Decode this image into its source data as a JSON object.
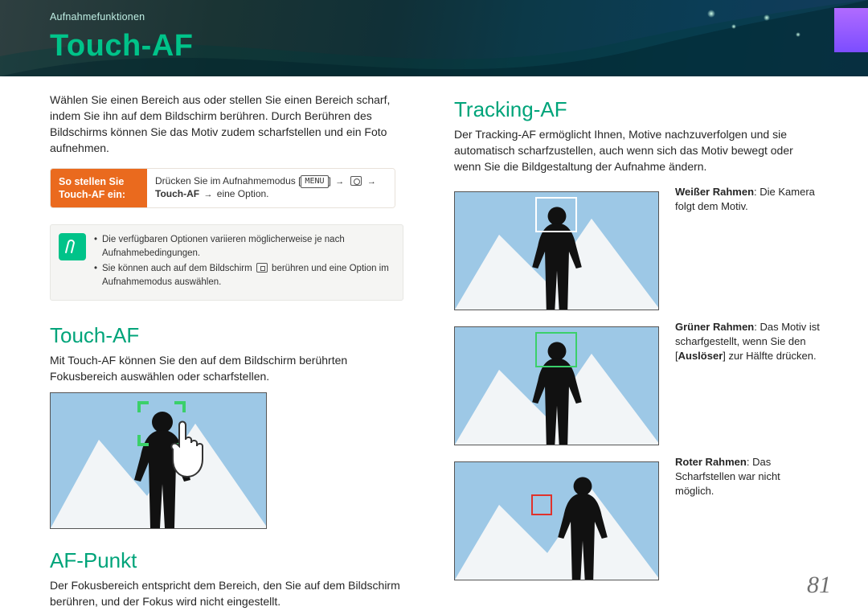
{
  "header": {
    "breadcrumb": "Aufnahmefunktionen",
    "title": "Touch-AF"
  },
  "left": {
    "intro": "Wählen Sie einen Bereich aus oder stellen Sie einen Bereich scharf, indem Sie ihn auf dem Bildschirm berühren. Durch Berühren des Bildschirms können Sie das Motiv zudem scharfstellen und ein Foto aufnehmen.",
    "instruct": {
      "label": "So stellen Sie Touch-AF ein:",
      "body_prefix": "Drücken Sie im Aufnahmemodus [",
      "body_menu": "MENU",
      "body_mid": "] ",
      "body_suffix": " eine Option.",
      "opt_strong": "Touch-AF"
    },
    "note": {
      "item1": "Die verfügbaren Optionen variieren möglicherweise je nach Aufnahmebedingungen.",
      "item2_a": "Sie können auch auf dem Bildschirm ",
      "item2_b": " berühren und eine Option im Aufnahmemodus auswählen."
    },
    "touch": {
      "heading": "Touch-AF",
      "body": "Mit Touch-AF können Sie den auf dem Bildschirm berührten Fokusbereich auswählen oder scharfstellen."
    },
    "afpunkt": {
      "heading": "AF-Punkt",
      "body": "Der Fokusbereich entspricht dem Bereich, den Sie auf dem Bildschirm berühren, und der Fokus wird nicht eingestellt."
    }
  },
  "right": {
    "heading": "Tracking-AF",
    "intro": "Der Tracking-AF ermöglicht Ihnen, Motive nachzuverfolgen und sie automatisch scharfzustellen, auch wenn sich das Motiv bewegt oder wenn Sie die Bildgestaltung der Aufnahme ändern.",
    "rows": {
      "white_b": "Weißer Rahmen",
      "white_t": ": Die Kamera folgt dem Motiv.",
      "green_b": "Grüner Rahmen",
      "green_t1": ": Das Motiv ist scharfgestellt, wenn Sie den [",
      "green_btn": "Auslöser",
      "green_t2": "] zur Hälfte drücken.",
      "red_b": "Roter Rahmen",
      "red_t": ": Das Scharfstellen war nicht möglich."
    }
  },
  "page_number": "81"
}
